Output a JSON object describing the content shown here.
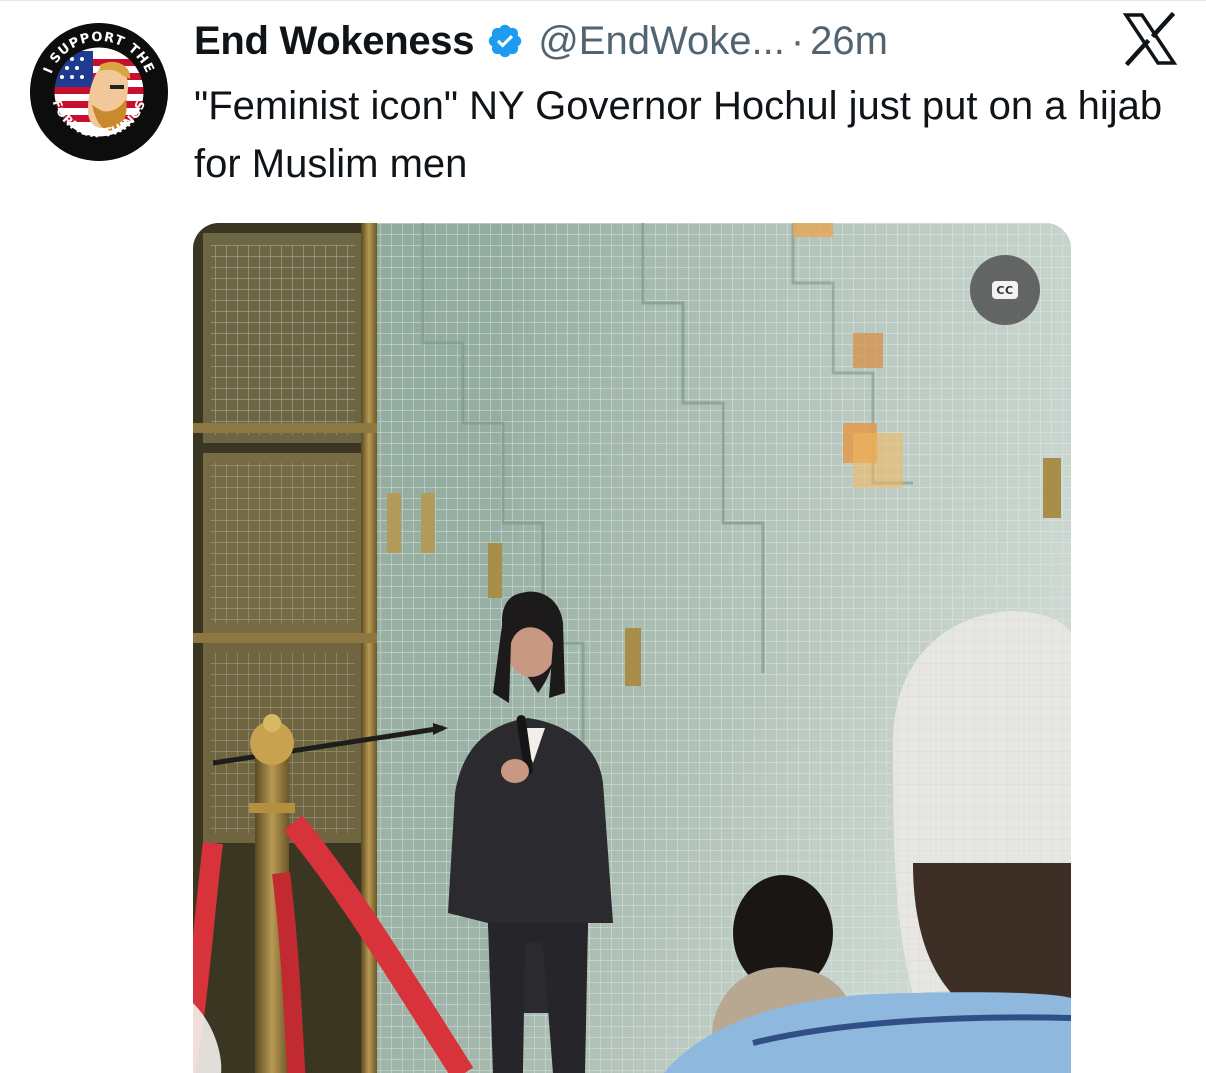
{
  "tweet": {
    "display_name": "End Wokeness",
    "handle": "@EndWoke...",
    "separator": "·",
    "timestamp": "26m",
    "text": "\"Feminist icon\" NY Governor Hochul just put on a hijab for Muslim men",
    "verified": true
  },
  "avatar": {
    "top_text": "I SUPPORT THE",
    "bottom_text": "FORMER THINGS"
  },
  "media": {
    "type": "video",
    "cc_label": "CC"
  },
  "icons": {
    "verified": "verified-badge-icon",
    "platform": "x-logo-icon",
    "captions": "closed-captions-icon"
  },
  "colors": {
    "verified_blue": "#1d9bf0",
    "secondary_text": "#536471",
    "primary_text": "#0f1419"
  }
}
